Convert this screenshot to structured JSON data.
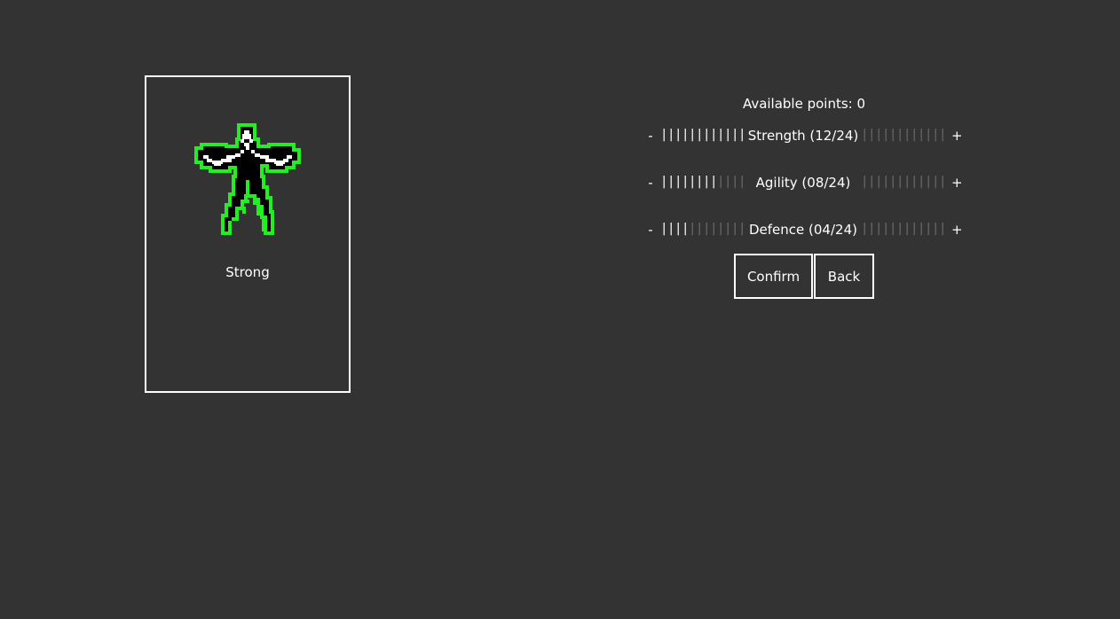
{
  "character": {
    "name": "Strong",
    "sprite_icon": "strong-hero-sprite-icon",
    "sprite_colors": {
      "outline": "#22ee22",
      "body": "#ffffff",
      "shade": "#000000"
    }
  },
  "points": {
    "label": "Available points: 0",
    "available": 0
  },
  "stats": [
    {
      "key": "strength",
      "label": "Strength (12/24)",
      "value": 12,
      "max": 24,
      "minus": "-",
      "plus": "+"
    },
    {
      "key": "agility",
      "label": "Agility (08/24)",
      "value": 8,
      "max": 24,
      "minus": "-",
      "plus": "+"
    },
    {
      "key": "defence",
      "label": "Defence (04/24)",
      "value": 4,
      "max": 24,
      "minus": "-",
      "plus": "+"
    }
  ],
  "buttons": {
    "confirm": "Confirm",
    "back": "Back"
  },
  "colors": {
    "background": "#333333",
    "text": "#ffffff",
    "tick_on": "#ffffff",
    "tick_off": "#6a6a6a"
  }
}
